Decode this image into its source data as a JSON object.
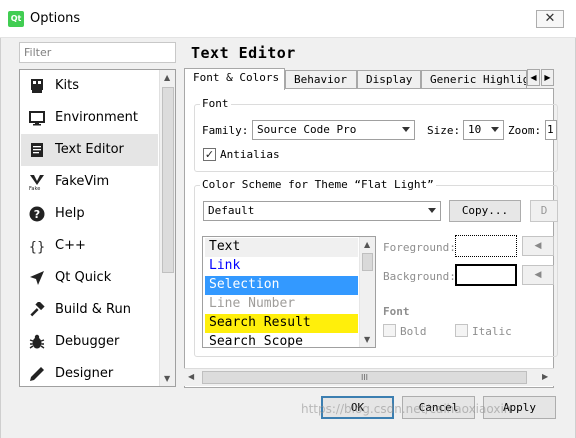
{
  "window": {
    "title": "Options",
    "app_icon": "qt-logo-icon",
    "close_icon": "close-icon"
  },
  "filter": {
    "placeholder": "Filter"
  },
  "categories": [
    {
      "label": "Kits",
      "icon": "kits-icon"
    },
    {
      "label": "Environment",
      "icon": "monitor-icon"
    },
    {
      "label": "Text Editor",
      "icon": "text-editor-icon",
      "selected": true
    },
    {
      "label": "FakeVim",
      "icon": "fakevim-icon"
    },
    {
      "label": "Help",
      "icon": "help-icon"
    },
    {
      "label": "C++",
      "icon": "braces-icon"
    },
    {
      "label": "Qt Quick",
      "icon": "qt-quick-icon"
    },
    {
      "label": "Build & Run",
      "icon": "hammer-icon"
    },
    {
      "label": "Debugger",
      "icon": "bug-icon"
    },
    {
      "label": "Designer",
      "icon": "pen-icon"
    }
  ],
  "main": {
    "title": "Text Editor",
    "tabs": [
      "Font & Colors",
      "Behavior",
      "Display",
      "Generic Highlighter"
    ],
    "font_group": {
      "title": "Font",
      "family_label": "Family:",
      "family_value": "Source Code Pro",
      "size_label": "Size:",
      "size_value": "10",
      "zoom_label": "Zoom:",
      "zoom_value": "1",
      "antialias_label": "Antialias",
      "antialias_checked": true
    },
    "scheme_group": {
      "title": "Color Scheme for Theme “Flat Light”",
      "scheme_value": "Default",
      "copy_label": "Copy...",
      "delete_label_partial": "D"
    },
    "items": [
      {
        "label": "Text",
        "color": "#000000",
        "bg": "#f0f0f0"
      },
      {
        "label": "Link",
        "color": "#0000ff",
        "bg": "#ffffff"
      },
      {
        "label": "Selection",
        "color": "#ffffff",
        "bg": "#3399ff"
      },
      {
        "label": "Line Number",
        "color": "#9f9d9a",
        "bg": "#ffffff"
      },
      {
        "label": "Search Result",
        "color": "#000000",
        "bg": "#ffef0b"
      },
      {
        "label": "Search Scope",
        "color": "#000000",
        "bg": "#ffffff"
      }
    ],
    "foreground_label": "Foreground:",
    "background_label": "Background:",
    "font_label": "Font",
    "bold_label": "Bold",
    "italic_label": "Italic",
    "hscroll_grip": "III"
  },
  "buttons": {
    "ok": "OK",
    "cancel": "Cancel",
    "apply": "Apply"
  },
  "watermark": "https://blog.csdn.net/caihaoxiaoxin"
}
